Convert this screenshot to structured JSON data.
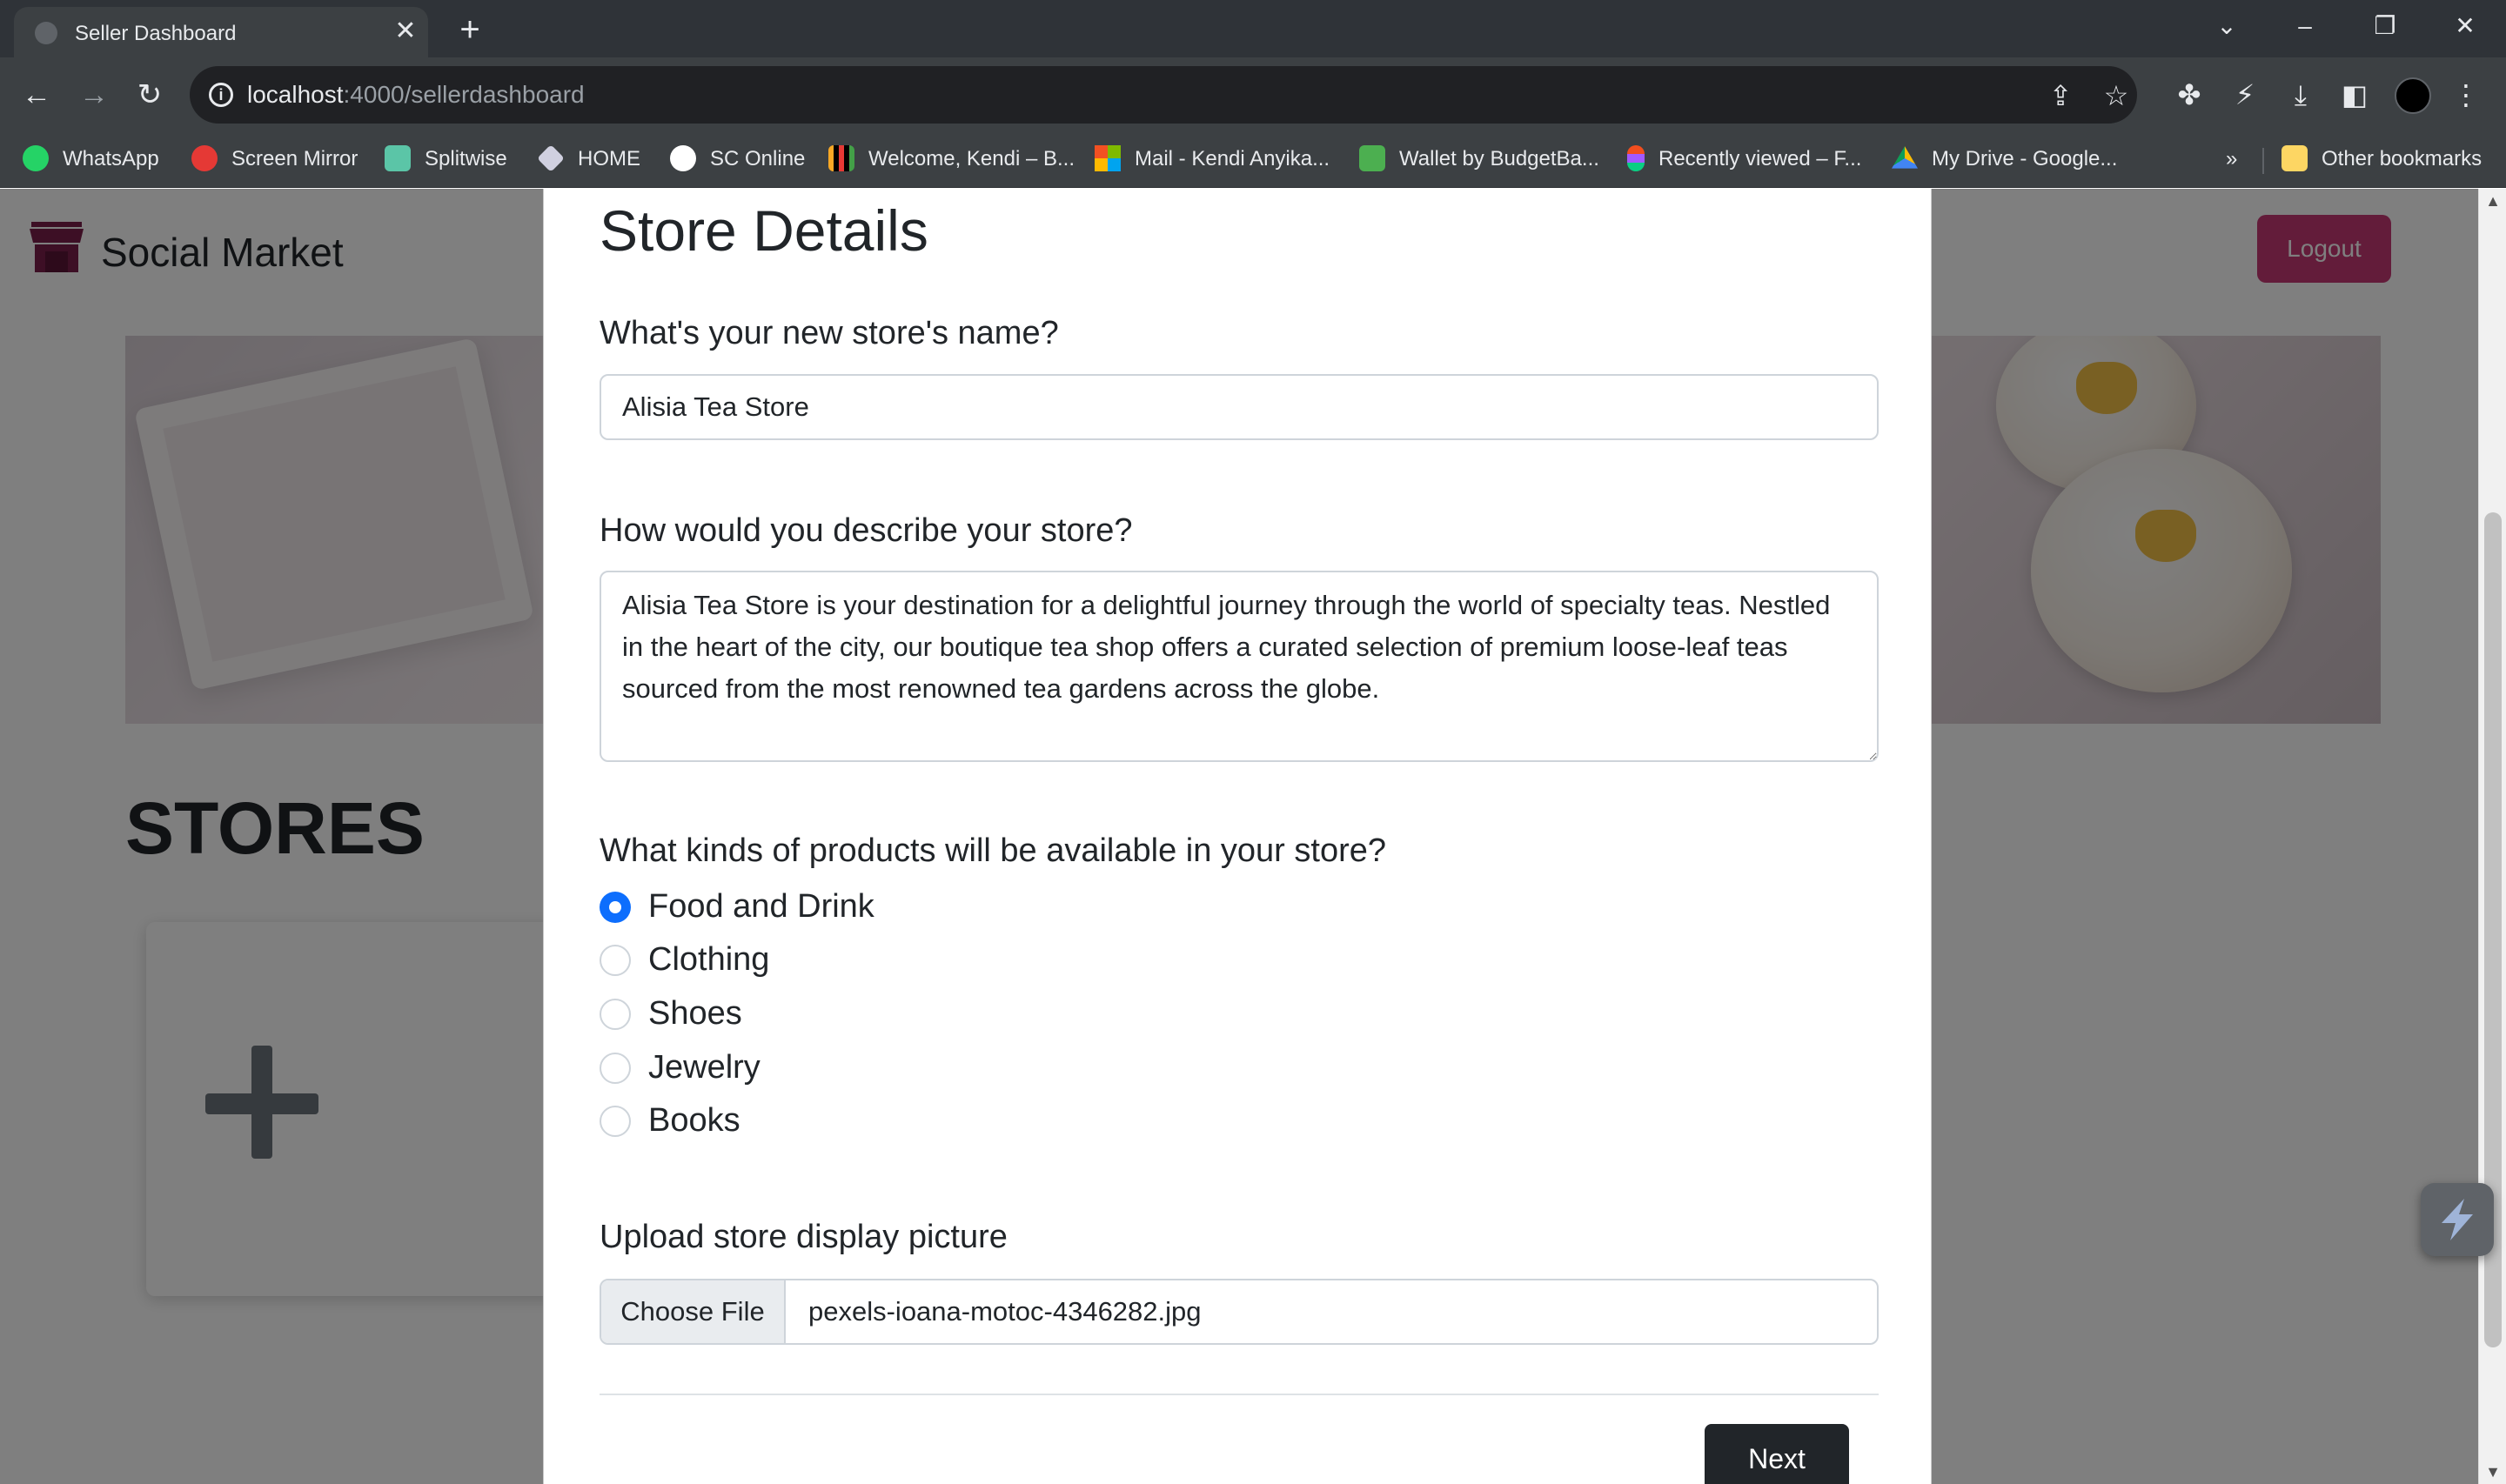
{
  "browser": {
    "tab_title": "Seller Dashboard",
    "url_host": "localhost",
    "url_rest": ":4000/sellerdashboard",
    "bookmarks": [
      {
        "label": "WhatsApp",
        "color": "#25d366"
      },
      {
        "label": "Screen Mirror",
        "color": "#e53935"
      },
      {
        "label": "Splitwise",
        "color": "#5bc5a7"
      },
      {
        "label": "HOME",
        "color": "#d0d0e0"
      },
      {
        "label": "SC Online",
        "color": "#ffffff"
      },
      {
        "label": "Welcome, Kendi – B...",
        "color": "#f9a825"
      },
      {
        "label": "Mail - Kendi Anyika...",
        "color": "#f25022"
      },
      {
        "label": "Wallet by BudgetBa...",
        "color": "#4caf50"
      },
      {
        "label": "Recently viewed – F...",
        "color": "#a259ff"
      },
      {
        "label": "My Drive - Google...",
        "color": "#fbbc04"
      }
    ],
    "overflow_label": "»",
    "other_bookmarks": "Other bookmarks"
  },
  "header": {
    "brand": "Social Market",
    "logout_label": "Logout"
  },
  "dashboard": {
    "stores_heading": "STORES"
  },
  "modal": {
    "title": "Store Details",
    "name_label": "What's your new store's name?",
    "name_value": "Alisia Tea Store",
    "description_label": "How would you describe your store?",
    "description_value": "Alisia Tea Store is your destination for a delightful journey through the world of specialty teas. Nestled in the heart of the city, our boutique tea shop offers a curated selection of premium loose-leaf teas sourced from the most renowned tea gardens across the globe.",
    "products_label": "What kinds of products will be available in your store?",
    "product_options": [
      {
        "label": "Food and Drink",
        "checked": true
      },
      {
        "label": "Clothing",
        "checked": false
      },
      {
        "label": "Shoes",
        "checked": false
      },
      {
        "label": "Jewelry",
        "checked": false
      },
      {
        "label": "Books",
        "checked": false
      }
    ],
    "upload_label": "Upload store display picture",
    "choose_file_label": "Choose File",
    "file_name": "pexels-ioana-motoc-4346282.jpg",
    "next_label": "Next"
  },
  "colors": {
    "brand_logo": "#7b1f4b",
    "logout": "#c73875",
    "radio_checked": "#0d6efd",
    "next_button": "#212529"
  }
}
